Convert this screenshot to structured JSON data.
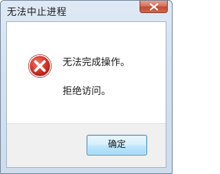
{
  "window": {
    "title": "无法中止进程"
  },
  "dialog": {
    "message_primary": "无法完成操作。",
    "message_secondary": "拒绝访问。",
    "icon": "error-icon"
  },
  "buttons": {
    "ok_label": "确定"
  },
  "colors": {
    "error_red": "#d9362a",
    "close_button": "#c94c34",
    "button_border": "#3c7fb1"
  }
}
